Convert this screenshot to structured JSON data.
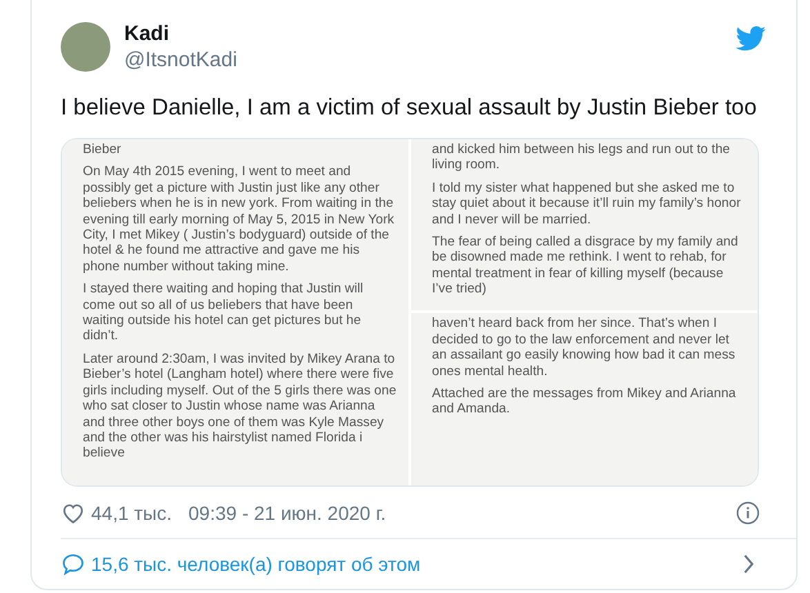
{
  "author": {
    "name": "Kadi",
    "handle": "@ItsnotKadi"
  },
  "tweet_text": "I believe Danielle, I am a victim of sexual assault by Justin Bieber too",
  "media_columns": [
    [
      {
        "paragraphs": [
          "Bieber",
          "On May 4th 2015 evening, I went to meet and possibly get a picture with Justin just like any other beliebers when he is in new york. From waiting in the evening till early morning of May 5, 2015 in New York City, I met Mikey ( Justin’s bodyguard) outside of the hotel & he found me attractive and gave me his phone number without taking mine.",
          "I stayed there waiting and hoping that Justin will come out so all of us beliebers that have been waiting outside his hotel can get pictures but he didn’t.",
          "Later around 2:30am, I was invited by Mikey Arana to Bieber’s hotel (Langham hotel) where there were five girls including myself. Out of the 5 girls there was one who sat closer to Justin whose name was Arianna and three other boys one of them was Kyle Massey and the other was his hairstylist named Florida i believe"
        ]
      }
    ],
    [
      {
        "paragraphs": [
          "and kicked him between his legs and run out to the living room.",
          "I told my sister what happened but she asked me to stay quiet about it because it’ll ruin my family’s honor and I never will be married.",
          "The fear of being called a disgrace by my family and be disowned made me rethink. I went to rehab, for mental treatment in fear of killing myself (because I’ve tried)"
        ]
      },
      {
        "paragraphs": [
          "haven’t heard back from her since. That’s when I decided to go to the law enforcement and never let an assailant go easily knowing how bad it can mess ones mental health.",
          "Attached are the messages from Mikey and Arianna and Amanda."
        ]
      }
    ]
  ],
  "footer": {
    "likes": "44,1 тыс.",
    "timestamp": "09:39 - 21 июн. 2020 г."
  },
  "conversation": "15,6 тыс. человек(а) говорят об этом"
}
